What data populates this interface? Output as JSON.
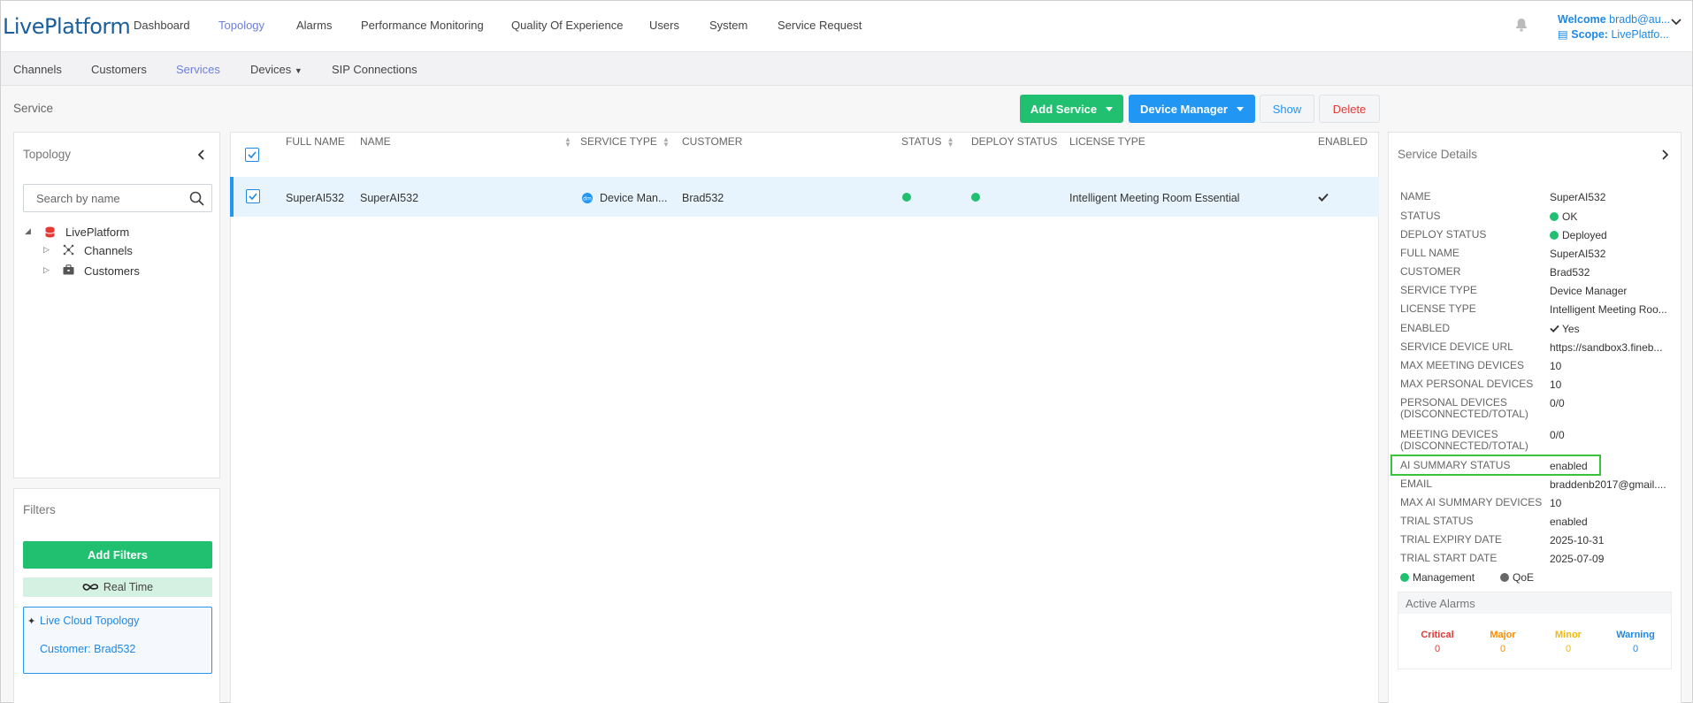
{
  "header": {
    "logo": "LivePlatform",
    "nav": [
      "Dashboard",
      "Topology",
      "Alarms",
      "Performance Monitoring",
      "Quality Of Experience",
      "Users",
      "System",
      "Service Request"
    ],
    "active_nav": "Topology",
    "welcome_label": "Welcome",
    "welcome_user": "bradb@au...",
    "scope_label": "Scope:",
    "scope_value": "LivePlatfo..."
  },
  "subnav": {
    "items": [
      "Channels",
      "Customers",
      "Services",
      "Devices",
      "SIP Connections"
    ],
    "active": "Services"
  },
  "page": {
    "title": "Service",
    "buttons": {
      "add_service": "Add Service",
      "device_manager": "Device Manager",
      "show": "Show",
      "delete": "Delete"
    }
  },
  "topology": {
    "title": "Topology",
    "search_placeholder": "Search by name",
    "tree": {
      "root": "LivePlatform",
      "children": [
        "Channels",
        "Customers"
      ]
    }
  },
  "filters": {
    "title": "Filters",
    "add_label": "Add Filters",
    "realtime_label": "Real Time",
    "pinned_title": "Live Cloud Topology",
    "pinned_customer": "Customer: Brad532"
  },
  "table": {
    "headers": [
      "FULL NAME",
      "NAME",
      "SERVICE TYPE",
      "CUSTOMER",
      "STATUS",
      "DEPLOY STATUS",
      "LICENSE TYPE",
      "ENABLED"
    ],
    "rows": [
      {
        "full_name": "SuperAI532",
        "name": "SuperAI532",
        "service_type": "Device Man...",
        "customer": "Brad532",
        "status": "ok",
        "deploy_status": "deployed",
        "license_type": "Intelligent Meeting Room Essential",
        "enabled": "yes"
      }
    ]
  },
  "details": {
    "title": "Service Details",
    "fields": [
      {
        "label": "NAME",
        "value": "SuperAI532"
      },
      {
        "label": "STATUS",
        "value": "OK"
      },
      {
        "label": "DEPLOY STATUS",
        "value": "Deployed"
      },
      {
        "label": "FULL NAME",
        "value": "SuperAI532"
      },
      {
        "label": "CUSTOMER",
        "value": "Brad532"
      },
      {
        "label": "SERVICE TYPE",
        "value": "Device Manager"
      },
      {
        "label": "LICENSE TYPE",
        "value": "Intelligent Meeting Roo..."
      },
      {
        "label": "ENABLED",
        "value": "Yes"
      },
      {
        "label": "SERVICE DEVICE URL",
        "value": "https://sandbox3.fineb..."
      },
      {
        "label": "MAX MEETING DEVICES",
        "value": "10"
      },
      {
        "label": "MAX PERSONAL DEVICES",
        "value": "10"
      },
      {
        "label": "PERSONAL DEVICES (DISCONNECTED/TOTAL)",
        "value": "0/0"
      },
      {
        "label": "MEETING DEVICES (DISCONNECTED/TOTAL)",
        "value": "0/0"
      },
      {
        "label": "AI SUMMARY STATUS",
        "value": "enabled"
      },
      {
        "label": "EMAIL",
        "value": "braddenb2017@gmail...."
      },
      {
        "label": "MAX AI SUMMARY DEVICES",
        "value": "10"
      },
      {
        "label": "TRIAL STATUS",
        "value": "enabled"
      },
      {
        "label": "TRIAL EXPIRY DATE",
        "value": "2025-10-31"
      },
      {
        "label": "TRIAL START DATE",
        "value": "2025-07-09"
      }
    ],
    "legend": [
      "Management",
      "QoE"
    ],
    "alarms": {
      "title": "Active Alarms",
      "items": [
        {
          "label": "Critical",
          "count": "0",
          "color": "#e53935"
        },
        {
          "label": "Major",
          "count": "0",
          "color": "#fb8c00"
        },
        {
          "label": "Minor",
          "count": "0",
          "color": "#f5b800"
        },
        {
          "label": "Warning",
          "count": "0",
          "color": "#1e88e5"
        }
      ]
    }
  },
  "colors": {
    "accent": "#2196f3",
    "green": "#21c070",
    "active_nav": "#6c7fdc",
    "highlight": "#3ac23c"
  }
}
